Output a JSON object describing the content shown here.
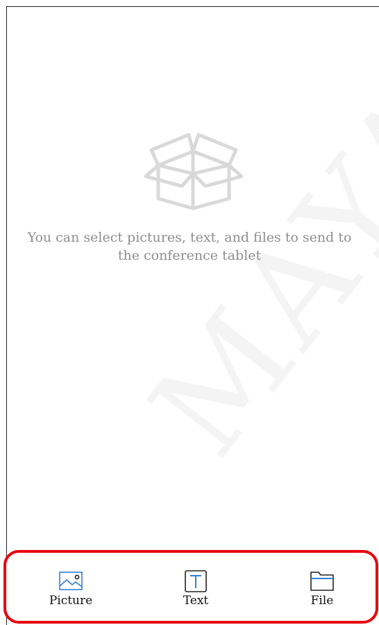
{
  "empty_state": {
    "icon": "open-box-icon",
    "message_line1": "You can select pictures, text, and files to send to",
    "message_line2": "the conference tablet"
  },
  "bottom_bar": {
    "items": [
      {
        "label": "Picture",
        "icon": "picture-icon"
      },
      {
        "label": "Text",
        "icon": "text-icon"
      },
      {
        "label": "File",
        "icon": "folder-icon"
      }
    ]
  },
  "colors": {
    "accent": "#2f7fd8",
    "highlight_border": "#e8000d",
    "muted_text": "#8e8e8e"
  },
  "watermark": "MAYA"
}
